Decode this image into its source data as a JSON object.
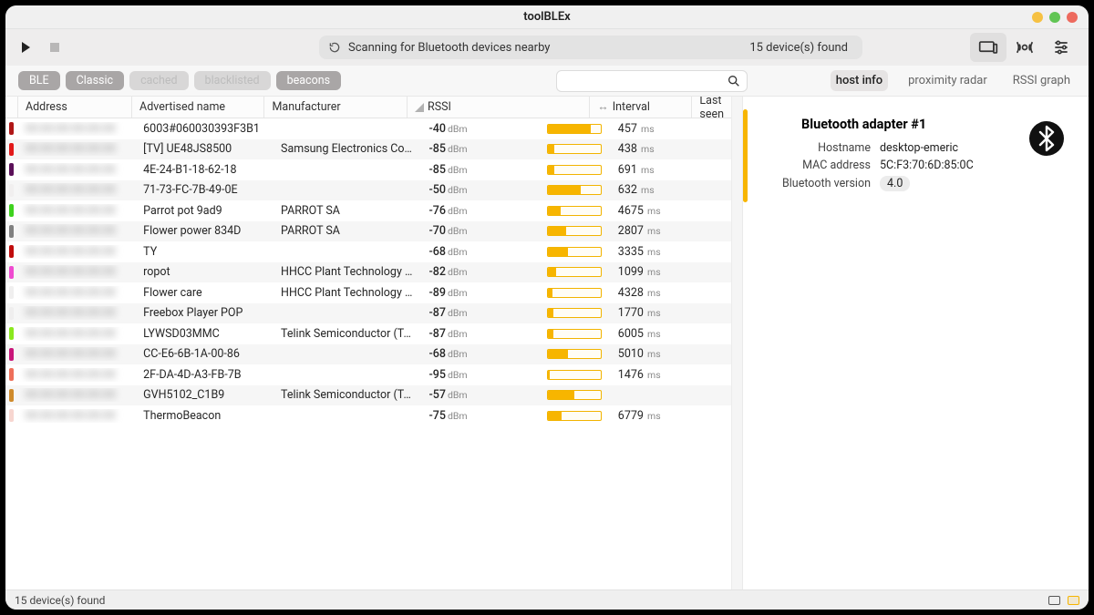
{
  "title": "toolBLEx",
  "toolbar": {
    "scan_status": "Scanning for Bluetooth devices nearby",
    "device_count": "15 device(s) found"
  },
  "filters": {
    "chips": [
      {
        "label": "BLE",
        "on": true
      },
      {
        "label": "Classic",
        "on": true
      },
      {
        "label": "cached",
        "on": false
      },
      {
        "label": "blacklisted",
        "on": false
      },
      {
        "label": "beacons",
        "on": true
      }
    ]
  },
  "tabs": {
    "items": [
      "host info",
      "proximity radar",
      "RSSI graph"
    ],
    "active": 0
  },
  "columns": {
    "addr": "Address",
    "name": "Advertised name",
    "mfr": "Manufacturer",
    "rssi": "RSSI",
    "interval": "Interval",
    "last": "Last seen"
  },
  "rows": [
    {
      "c": "#b01717",
      "addr": "00:00:00:00:00:00",
      "name": "6003#060030393F3B1",
      "mfr": "",
      "rssi": -40,
      "bar": 0.8,
      "int": 457
    },
    {
      "c": "#e21a1a",
      "addr": "00:00:00:00:00:00",
      "name": "[TV] UE48JS8500",
      "mfr": "Samsung Electronics Co. Ltd.",
      "rssi": -85,
      "bar": 0.12,
      "int": 438
    },
    {
      "c": "#5b1059",
      "addr": "00:00:00:00:00:00",
      "name": "4E-24-B1-18-62-18",
      "mfr": "",
      "rssi": -85,
      "bar": 0.12,
      "int": 691
    },
    {
      "c": "#f1efef",
      "addr": "00:00:00:00:00:00",
      "name": "71-73-FC-7B-49-0E",
      "mfr": "",
      "rssi": -50,
      "bar": 0.62,
      "int": 632
    },
    {
      "c": "#3fd21e",
      "addr": "00:00:00:00:00:00",
      "name": "Parrot pot 9ad9",
      "mfr": "PARROT SA",
      "rssi": -76,
      "bar": 0.24,
      "int": 4675
    },
    {
      "c": "#808080",
      "addr": "00:00:00:00:00:00",
      "name": "Flower power 834D",
      "mfr": "PARROT SA",
      "rssi": -70,
      "bar": 0.34,
      "int": 2807
    },
    {
      "c": "#c00c0c",
      "addr": "00:00:00:00:00:00",
      "name": "TY",
      "mfr": "",
      "rssi": -68,
      "bar": 0.37,
      "int": 3335
    },
    {
      "c": "#ef4bd0",
      "addr": "00:00:00:00:00:00",
      "name": "ropot",
      "mfr": "HHCC Plant Technology Co.…",
      "rssi": -82,
      "bar": 0.16,
      "int": 1099
    },
    {
      "c": "#f0efef",
      "addr": "00:00:00:00:00:00",
      "name": "Flower care",
      "mfr": "HHCC Plant Technology Co.…",
      "rssi": -89,
      "bar": 0.08,
      "int": 4328
    },
    {
      "c": "#efeeee",
      "addr": "00:00:00:00:00:00",
      "name": "Freebox Player POP",
      "mfr": "",
      "rssi": -87,
      "bar": 0.1,
      "int": 1770
    },
    {
      "c": "#8be81e",
      "addr": "00:00:00:00:00:00",
      "name": "LYWSD03MMC",
      "mfr": "Telink Semiconductor (Taip…",
      "rssi": -87,
      "bar": 0.1,
      "int": 6005
    },
    {
      "c": "#c9167a",
      "addr": "00:00:00:00:00:00",
      "name": "CC-E6-6B-1A-00-86",
      "mfr": "",
      "rssi": -68,
      "bar": 0.37,
      "int": 5010
    },
    {
      "c": "#ee6f5a",
      "addr": "00:00:00:00:00:00",
      "name": "2F-DA-4D-A3-FB-7B",
      "mfr": "",
      "rssi": -95,
      "bar": 0.04,
      "int": 1476
    },
    {
      "c": "#cf8a2b",
      "addr": "00:00:00:00:00:00",
      "name": "GVH5102_C1B9",
      "mfr": "Telink Semiconductor (Taip…",
      "rssi": -57,
      "bar": 0.5,
      "int": null
    },
    {
      "c": "#f7d6d0",
      "addr": "00:00:00:00:00:00",
      "name": "ThermoBeacon",
      "mfr": "",
      "rssi": -75,
      "bar": 0.26,
      "int": 6779
    }
  ],
  "units": {
    "rssi": "dBm",
    "interval": "ms"
  },
  "side": {
    "title": "Bluetooth adapter #1",
    "hostname_label": "Hostname",
    "hostname": "desktop-emeric",
    "mac_label": "MAC address",
    "mac": "5C:F3:70:6D:85:0C",
    "btver_label": "Bluetooth version",
    "btver": "4.0"
  },
  "statusbar": {
    "text": "15 device(s) found"
  }
}
